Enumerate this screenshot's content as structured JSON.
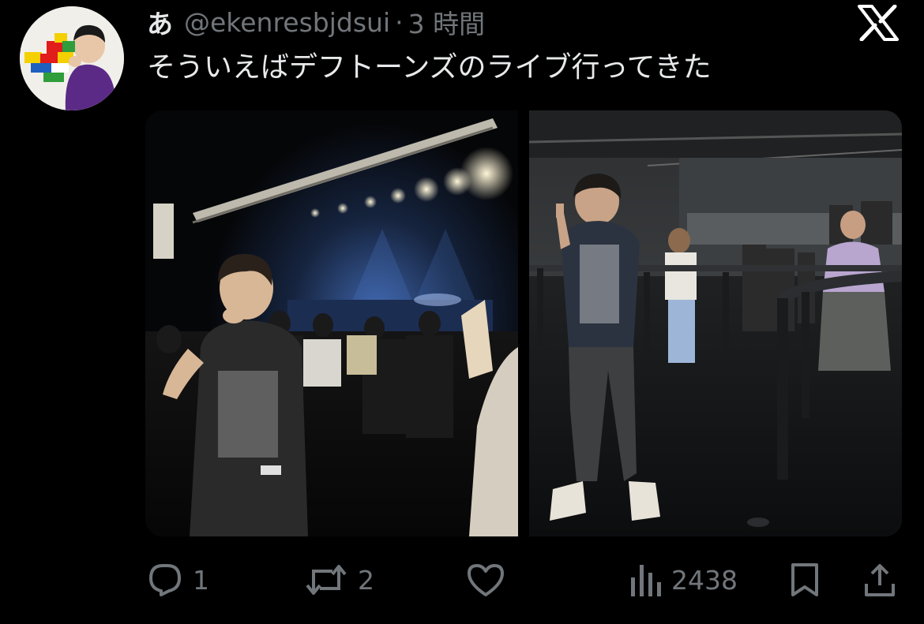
{
  "tweet": {
    "display_name": "あ",
    "handle": "@ekenresbjdsui",
    "separator": "·",
    "time": "3 時間",
    "text": "そういえばデフトーンズのライブ行ってきた"
  },
  "icons": {
    "brand": "x-logo-icon",
    "reply": "reply-icon",
    "retweet": "retweet-icon",
    "like": "heart-icon",
    "views": "views-icon",
    "bookmark": "bookmark-icon",
    "share": "share-icon"
  },
  "media": {
    "photo_count": 2
  },
  "stats": {
    "replies": "1",
    "retweets": "2",
    "views": "2438"
  },
  "colors": {
    "background": "#000000",
    "text_primary": "#e7e9ea",
    "text_secondary": "#71767b"
  }
}
